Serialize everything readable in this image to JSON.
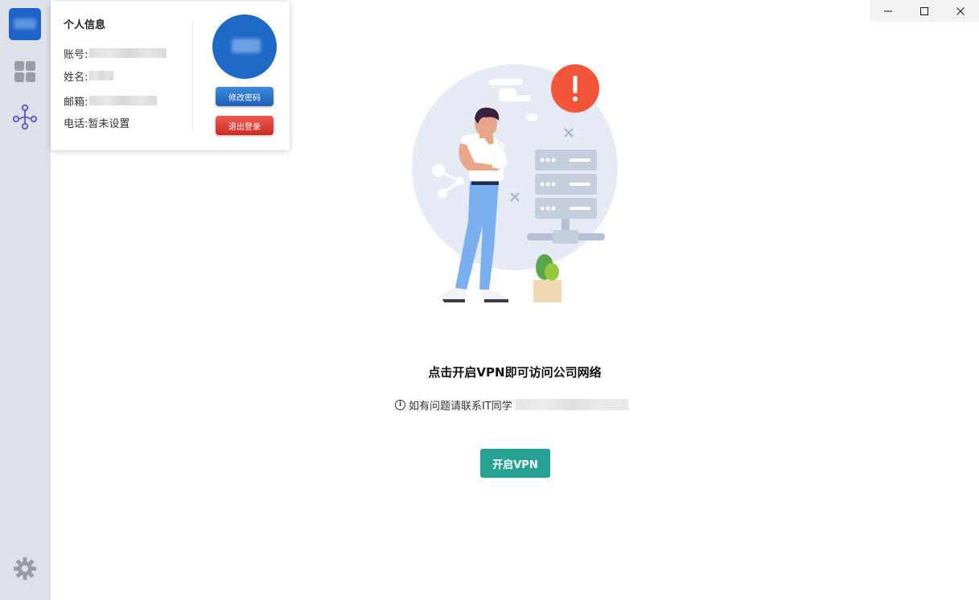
{
  "sidebar": {
    "items": [
      {
        "icon": "app-logo"
      },
      {
        "icon": "apps-grid-icon"
      },
      {
        "icon": "network-nodes-icon",
        "active": true
      },
      {
        "icon": "gear-icon"
      }
    ],
    "colors": {
      "background": "#dfe1e8",
      "accent": "#6b5bd6",
      "logo": "#1e63c8"
    }
  },
  "window": {
    "controls": [
      "minimize",
      "maximize",
      "close"
    ]
  },
  "profile": {
    "title": "个人信息",
    "account_label": "账号:",
    "name_label": "姓名:",
    "email_label": "邮箱:",
    "phone_label": "电话:",
    "phone_value": "暂未设置",
    "change_password_label": "修改密码",
    "logout_label": "退出登录"
  },
  "main": {
    "headline": "点击开启VPN即可访问公司网络",
    "hint": "如有问题请联系IT同学",
    "vpn_button_label": "开启VPN",
    "colors": {
      "vpn_button": "#26a294",
      "alert": "#f2553a"
    }
  }
}
